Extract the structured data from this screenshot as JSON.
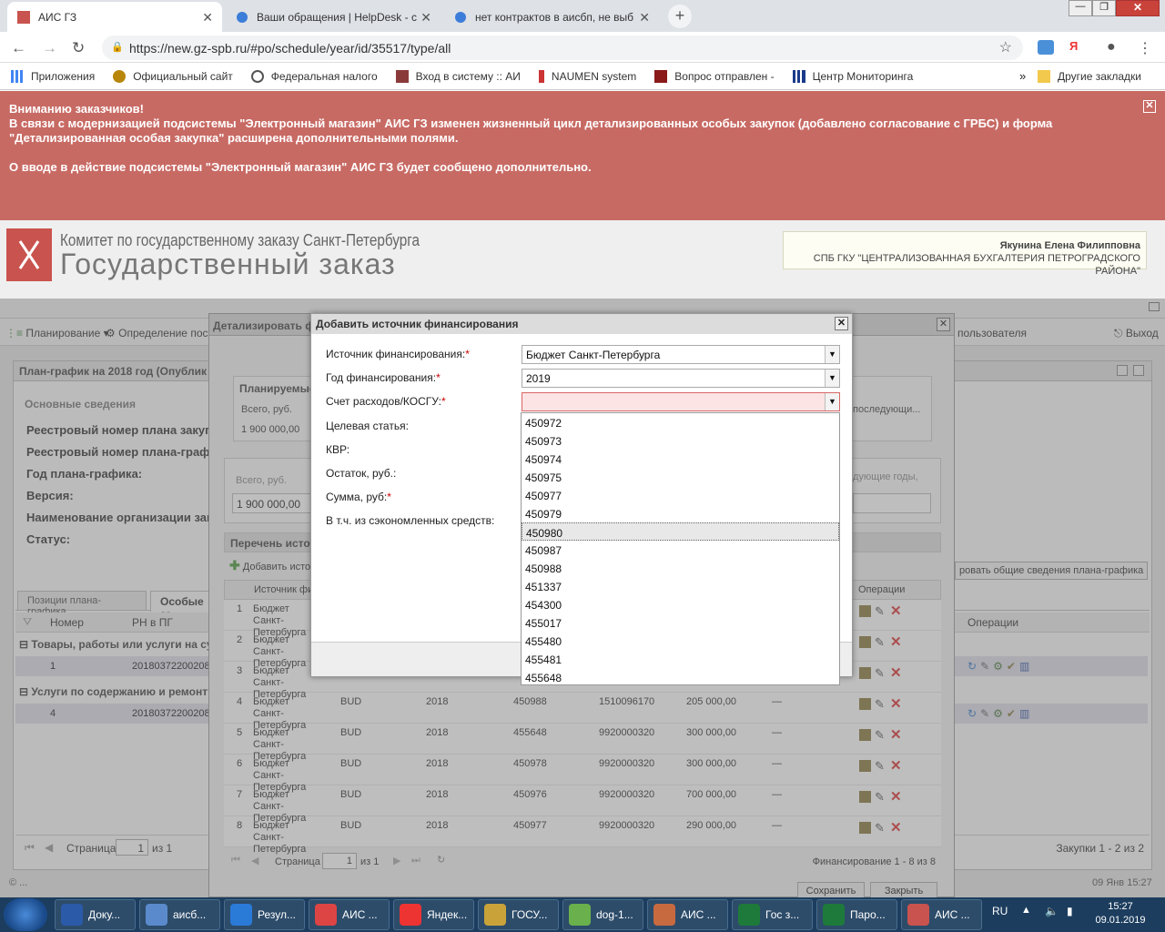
{
  "browser": {
    "tabs": [
      {
        "title": "АИС ГЗ"
      },
      {
        "title": "Ваши обращения | HelpDesk - с"
      },
      {
        "title": "нет контрактов в аисбп, не выб"
      }
    ],
    "url": "https://new.gz-spb.ru/#po/schedule/year/id/35517/type/all",
    "bookmarks": [
      "Приложения",
      "Официальный сайт",
      "Федеральная налого",
      "Вход в систему :: АИ",
      "NAUMEN system",
      "Вопрос отправлен -",
      "Центр Мониторинга"
    ],
    "other_bookmarks": "Другие закладки",
    "more": "»"
  },
  "banner": {
    "line1": "Вниманию заказчиков!",
    "line2": "В связи с модернизацией подсистемы \"Электронный магазин\" АИС ГЗ изменен жизненный цикл детализированных особых закупок (добавлено согласование с ГРБС) и форма \"Детализированная особая закупка\" расширена дополнительными полями.",
    "line3": "О вводе в действие подсистемы \"Электронный магазин\" АИС ГЗ будет сообщено дополнительно.",
    "close": "✕"
  },
  "header": {
    "org_line1": "Комитет по государственному заказу Санкт-Петербурга",
    "org_line2": "Государственный заказ",
    "user_name": "Якунина Елена Филипповна",
    "user_org": "СПБ ГКУ \"ЦЕНТРАЛИЗОВАННАЯ БУХГАЛТЕРИЯ ПЕТРОГРАДСКОГО РАЙОНА\""
  },
  "menu": {
    "planning": "Планирование ▾",
    "definition": "Определение пост",
    "user": "пользователя",
    "exit": "Выход"
  },
  "left_panel": {
    "title": "План-график на 2018 год (Опублик",
    "section": "Основные сведения",
    "fields": [
      "Реестровый номер плана закуп",
      "Реестровый номер плана-графи",
      "Год плана-графика:",
      "Версия:",
      "Наименование организации зак",
      "Статус:"
    ],
    "tabs": [
      "Позиции плана-графика",
      "Особые за"
    ],
    "col_number": "Номер",
    "col_rn": "РН в ПГ",
    "col_ops": "Операции",
    "group1": "Товары, работы или услуги на сум",
    "group2": "Услуги по содержанию и ремонту",
    "row1": {
      "num": "1",
      "rn": "20180372200208"
    },
    "row2": {
      "num": "4",
      "rn": "20180372200208"
    },
    "edit_general": "ровать общие сведения плана-графика",
    "page_label": "Страница",
    "page_num": "1",
    "page_of": "из 1",
    "purchases": "Закупки 1 - 2 из 2"
  },
  "detail_dialog": {
    "title": "Детализировать ф",
    "planned": "Планируемые",
    "total_label": "Всего, руб.",
    "total_value": "1 900 000,00",
    "next_years": "последующи...",
    "total_label2": "Всего, руб.",
    "total_value2": "1 900 000,00",
    "next_years2": "дующие годы,",
    "sources_title": "Перечень источ",
    "add_source": "Добавить исто",
    "col_source": "Источник фи",
    "col_ops": "Операции",
    "rows": [
      {
        "n": "1",
        "src": "Бюджет Санкт-Петербурга",
        "code": "",
        "year": "",
        "kosgu": "",
        "kcs": "",
        "sum": "",
        "dash": ""
      },
      {
        "n": "2",
        "src": "Бюджет Санкт-Петербурга",
        "code": "",
        "year": "",
        "kosgu": "",
        "kcs": "",
        "sum": "",
        "dash": ""
      },
      {
        "n": "3",
        "src": "Бюджет Санкт-Петербурга",
        "code": "",
        "year": "",
        "kosgu": "",
        "kcs": "",
        "sum": "",
        "dash": ""
      },
      {
        "n": "4",
        "src": "Бюджет Санкт-Петербурга",
        "code": "BUD",
        "year": "2018",
        "kosgu": "450988",
        "kcs": "1510096170",
        "sum": "205 000,00",
        "dash": "—"
      },
      {
        "n": "5",
        "src": "Бюджет Санкт-Петербурга",
        "code": "BUD",
        "year": "2018",
        "kosgu": "455648",
        "kcs": "9920000320",
        "sum": "300 000,00",
        "dash": "—"
      },
      {
        "n": "6",
        "src": "Бюджет Санкт-Петербурга",
        "code": "BUD",
        "year": "2018",
        "kosgu": "450978",
        "kcs": "9920000320",
        "sum": "300 000,00",
        "dash": "—"
      },
      {
        "n": "7",
        "src": "Бюджет Санкт-Петербурга",
        "code": "BUD",
        "year": "2018",
        "kosgu": "450976",
        "kcs": "9920000320",
        "sum": "700 000,00",
        "dash": "—"
      },
      {
        "n": "8",
        "src": "Бюджет Санкт-Петербурга",
        "code": "BUD",
        "year": "2018",
        "kosgu": "450977",
        "kcs": "9920000320",
        "sum": "290 000,00",
        "dash": "—"
      }
    ],
    "page_label": "Страница",
    "page_num": "1",
    "page_of": "из 1",
    "financing": "Финансирование 1 - 8 из 8",
    "save": "Сохранить",
    "close": "Закрыть"
  },
  "modal": {
    "title": "Добавить источник финансирования",
    "label_source": "Источник финансирования:",
    "label_year": "Год финансирования:",
    "label_account": "Счет расходов/КОСГУ:",
    "label_target": "Целевая статья:",
    "label_kvr": "КВР:",
    "label_balance": "Остаток, руб.:",
    "label_sum": "Сумма, руб:",
    "label_saved": "В т.ч. из сэкономленных средств:",
    "req": "*",
    "source_value": "Бюджет Санкт-Петербурга",
    "year_value": "2019",
    "account_value": ""
  },
  "dropdown": {
    "options": [
      "450972",
      "450973",
      "450974",
      "450975",
      "450977",
      "450979",
      "450980",
      "450987",
      "450988",
      "451337",
      "454300",
      "455017",
      "455480",
      "455481",
      "455648"
    ],
    "selected_index": 6
  },
  "status": {
    "copyright": "© ...",
    "datetime": "09 Янв 15:27"
  },
  "taskbar": {
    "items": [
      "Доку...",
      "аисб...",
      "Резул...",
      "АИС ...",
      "Яндек...",
      "ГОСУ...",
      "dog-1...",
      "АИС ...",
      "Гос з...",
      "Паро...",
      "АИС ..."
    ],
    "lang": "RU",
    "time": "15:27",
    "date": "09.01.2019"
  },
  "colors": {
    "banner": "#c86a64",
    "taskbar": "#1c3d5e",
    "error_field": "#fde4e4"
  }
}
